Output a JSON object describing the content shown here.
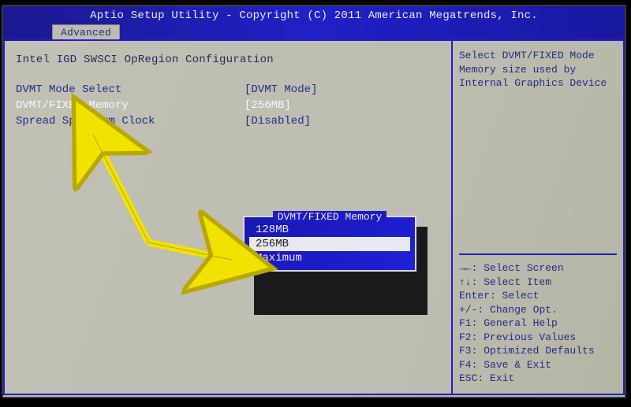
{
  "header": {
    "title": "Aptio Setup Utility - Copyright (C) 2011 American Megatrends, Inc.",
    "tab": "Advanced"
  },
  "main": {
    "section_title": "Intel IGD SWSCI OpRegion Configuration",
    "rows": [
      {
        "label": "DVMT Mode Select",
        "value": "[DVMT Mode]",
        "selected": false
      },
      {
        "label": "DVMT/FIXED Memory",
        "value": "[256MB]",
        "selected": true
      },
      {
        "label": "Spread Spectrum Clock",
        "value": "[Disabled]",
        "selected": false
      }
    ]
  },
  "popup": {
    "title": "DVMT/FIXED Memory",
    "items": [
      "128MB",
      "256MB",
      "Maximum"
    ],
    "highlight_index": 1
  },
  "help": {
    "text": "Select DVMT/FIXED Mode Memory size used by Internal Graphics Device"
  },
  "keys": [
    {
      "k": "→←:",
      "d": "Select Screen"
    },
    {
      "k": "↑↓:",
      "d": "Select Item"
    },
    {
      "k": "Enter:",
      "d": "Select"
    },
    {
      "k": "+/-:",
      "d": "Change Opt."
    },
    {
      "k": "F1:",
      "d": "General Help"
    },
    {
      "k": "F2:",
      "d": "Previous Values"
    },
    {
      "k": "F3:",
      "d": "Optimized Defaults"
    },
    {
      "k": "F4:",
      "d": "Save & Exit"
    },
    {
      "k": "ESC:",
      "d": "Exit"
    }
  ]
}
